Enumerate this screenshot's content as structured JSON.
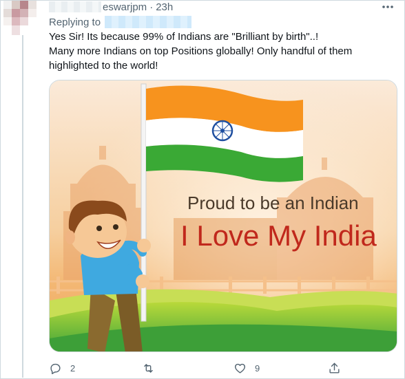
{
  "tweet": {
    "handle": "eswarjpm",
    "separator": "·",
    "time": "23h",
    "replying_to_label": "Replying to",
    "text_lines": [
      "Yes Sir! Its because 99% of Indians are \"Brilliant by birth\"..!",
      "Many more Indians on top Positions globally! Only handful of them",
      "highlighted to the world!"
    ]
  },
  "image": {
    "line1": "Proud to be  an Indian",
    "line2": "I Love My India",
    "colors": {
      "saffron": "#f7931e",
      "white": "#ffffff",
      "green": "#3aa935",
      "chakra": "#1f4fa0",
      "text_dark": "#4a3a2a",
      "text_red": "#c0281c"
    }
  },
  "actions": {
    "reply_icon": "reply-icon",
    "reply_count": "2",
    "retweet_icon": "retweet-icon",
    "retweet_count": "",
    "like_icon": "heart-icon",
    "like_count": "9",
    "share_icon": "share-icon"
  }
}
